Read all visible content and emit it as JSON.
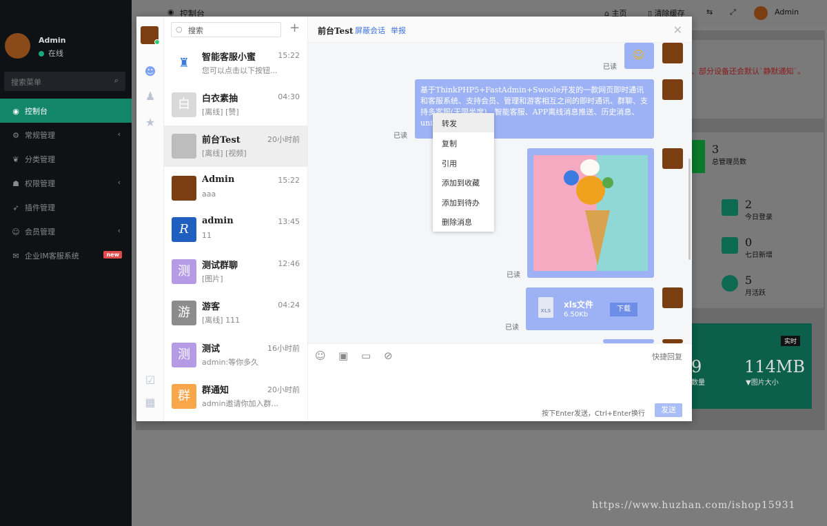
{
  "admin": {
    "user": {
      "name": "Admin",
      "status": "在线"
    },
    "search_placeholder": "搜索菜单",
    "menu": [
      {
        "label": "控制台",
        "icon": "dashboard-icon",
        "active": true
      },
      {
        "label": "常规管理",
        "icon": "cogs-icon",
        "chevron": true
      },
      {
        "label": "分类管理",
        "icon": "leaf-icon"
      },
      {
        "label": "权限管理",
        "icon": "group-icon",
        "chevron": true
      },
      {
        "label": "插件管理",
        "icon": "rocket-icon"
      },
      {
        "label": "会员管理",
        "icon": "user-circle-icon",
        "chevron": true
      },
      {
        "label": "企业IM客服系统",
        "icon": "comment-icon",
        "badge": "new"
      }
    ],
    "topbar": {
      "title": "控制台",
      "home": "主页",
      "clear_cache": "清除缓存",
      "user": "Admin"
    },
    "notice_text": "、部分设备还会默认`静默通知`。",
    "stats": [
      {
        "value": "3",
        "label": "总管理员数"
      },
      {
        "value": "2",
        "label": "今日登录"
      },
      {
        "value": "0",
        "label": "七日新增"
      },
      {
        "value": "5",
        "label": "月活跃"
      }
    ],
    "realtime": {
      "badge": "实时",
      "count_fragment": "9",
      "count_label": "数量",
      "size": "114MB",
      "size_label": "图片大小"
    },
    "watermark": "https://www.huzhan.com/ishop15931"
  },
  "chat": {
    "search_placeholder": "搜索",
    "conversations": [
      {
        "name": "智能客服小蜜",
        "time": "15:22",
        "preview": "您可以点击以下按钮...",
        "avatar_text": "",
        "avatar_color": "#ffffff"
      },
      {
        "name": "白衣素抽",
        "time": "04:30",
        "preview": "[离线] [赞]",
        "avatar_text": "白",
        "avatar_color": "#d9d9d9"
      },
      {
        "name": "前台Test",
        "time": "20小时前",
        "preview": "[离线] [视频]",
        "avatar_text": "",
        "avatar_color": "#bdbdbd"
      },
      {
        "name": "Admin",
        "time": "15:22",
        "preview": "aaa",
        "avatar_text": "",
        "avatar_color": "#7a3e12"
      },
      {
        "name": "admin",
        "time": "13:45",
        "preview": "11",
        "avatar_text": "R",
        "avatar_color": "#1e5fbf"
      },
      {
        "name": "测试群聊",
        "time": "12:46",
        "preview": "[图片]",
        "avatar_text": "测",
        "avatar_color": "#b59be6"
      },
      {
        "name": "游客",
        "time": "04:24",
        "preview": "[离线] 111",
        "avatar_text": "游",
        "avatar_color": "#8c8c8c"
      },
      {
        "name": "测试",
        "time": "16小时前",
        "preview": "admin:等你多久",
        "avatar_text": "测",
        "avatar_color": "#b59be6"
      },
      {
        "name": "群通知",
        "time": "20小时前",
        "preview": "admin邀请你加入群...",
        "avatar_text": "群",
        "avatar_color": "#f7a64a"
      }
    ],
    "header": {
      "peer": "前台Test",
      "block": "屏蔽会话",
      "report": "举报"
    },
    "messages": {
      "read_label": "已读",
      "text": "基于ThinkPHP5+FastAdmin+Swoole开发的一款网页即时通讯和客服系统、支持会员、管理和游客相互之间的即时通讯、群聊、支持多客服(无限坐席)、智能客服、APP离线消息推送、历史消息、uni-app",
      "file_name": "xls文件",
      "file_size": "6.50Kb",
      "download": "下载"
    },
    "context_menu": [
      "转发",
      "复制",
      "引用",
      "添加到收藏",
      "添加到待办",
      "删除消息"
    ],
    "footer": {
      "quick_reply": "快捷回复",
      "hint": "按下Enter发送，Ctrl+Enter换行",
      "send": "发送"
    }
  }
}
